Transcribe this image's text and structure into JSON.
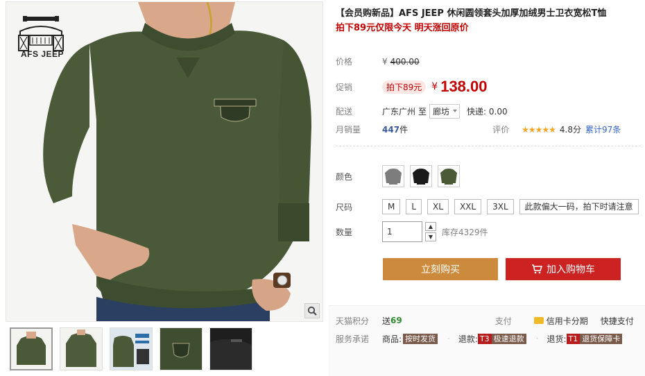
{
  "brand": {
    "logo_text": "AFS JEEP"
  },
  "product": {
    "title": "【会员购新品】AFS JEEP 休闲圆领套头加厚加绒男士卫衣宽松T恤",
    "promo_line": "拍下89元仅限今天 明天涨回原价"
  },
  "price": {
    "label": "价格",
    "currency": "¥",
    "original": "400.00",
    "promo_label": "促销",
    "promo_tag": "拍下89元",
    "current": "138.00"
  },
  "shipping": {
    "label": "配送",
    "from": "广东广州",
    "to_word": "至",
    "city": "廊坊",
    "express": "快递: 0.00"
  },
  "sales": {
    "label": "月销量",
    "count": "447",
    "unit": "件",
    "rating_label": "评价",
    "stars": "★★★★★",
    "score": "4.8分",
    "reviews": "累计97条"
  },
  "options": {
    "color_label": "颜色",
    "colors": [
      {
        "name": "grey",
        "hex": "#7d7d7d"
      },
      {
        "name": "black",
        "hex": "#1b1b1b"
      },
      {
        "name": "army-green",
        "hex": "#4b5a36"
      }
    ],
    "size_label": "尺码",
    "sizes": [
      "M",
      "L",
      "XL",
      "XXL",
      "3XL",
      "此款偏大一码，拍下时请注意"
    ],
    "qty_label": "数量",
    "qty_value": "1",
    "stock": "库存4329件"
  },
  "actions": {
    "buy_now": "立刻购买",
    "add_to_cart": "加入购物车"
  },
  "services": {
    "points_label": "天猫积分",
    "points_prefix": "送",
    "points_value": "69",
    "pay_label": "支付",
    "credit_label": "信用卡分期",
    "quick_pay": "快捷支付",
    "promise_label": "服务承诺",
    "goods_label": "商品:",
    "goods_tag": "按时发货",
    "refund_label": "退款:",
    "refund_code": "T3",
    "refund_tag": "极速退款",
    "return_label": "退货:",
    "return_code": "T1",
    "return_tag": "退货保障卡"
  },
  "colors": {
    "price_red": "#c40000",
    "buy_orange": "#cc8b3c",
    "cart_red": "#cc2222",
    "shirt_green": "#4a5a38"
  },
  "icons": [
    "logo-icon",
    "zoom-icon",
    "cart-icon",
    "credit-card-icon",
    "star-icon",
    "chevron-down-icon"
  ]
}
